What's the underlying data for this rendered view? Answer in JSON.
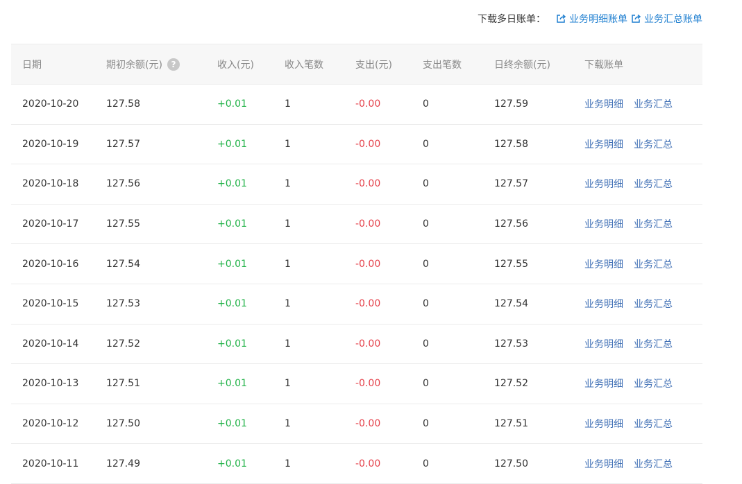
{
  "download_bar": {
    "label": "下载多日账单：",
    "links": [
      {
        "label": "业务明细账单",
        "icon": "external-link-icon"
      },
      {
        "label": "业务汇总账单",
        "icon": "external-link-icon"
      }
    ]
  },
  "table": {
    "headers": [
      "日期",
      "期初余额(元)",
      "收入(元)",
      "收入笔数",
      "支出(元)",
      "支出笔数",
      "日终余额(元)",
      "下载账单"
    ],
    "help_icon": "?",
    "row_links": [
      "业务明细",
      "业务汇总"
    ],
    "colors": {
      "income": "#20b247",
      "expense": "#e5414a",
      "link": "#3f6fb5"
    },
    "rows": [
      {
        "date": "2020-10-20",
        "opening": "127.58",
        "income": "+0.01",
        "income_count": "1",
        "expense": "-0.00",
        "expense_count": "0",
        "closing": "127.59"
      },
      {
        "date": "2020-10-19",
        "opening": "127.57",
        "income": "+0.01",
        "income_count": "1",
        "expense": "-0.00",
        "expense_count": "0",
        "closing": "127.58"
      },
      {
        "date": "2020-10-18",
        "opening": "127.56",
        "income": "+0.01",
        "income_count": "1",
        "expense": "-0.00",
        "expense_count": "0",
        "closing": "127.57"
      },
      {
        "date": "2020-10-17",
        "opening": "127.55",
        "income": "+0.01",
        "income_count": "1",
        "expense": "-0.00",
        "expense_count": "0",
        "closing": "127.56"
      },
      {
        "date": "2020-10-16",
        "opening": "127.54",
        "income": "+0.01",
        "income_count": "1",
        "expense": "-0.00",
        "expense_count": "0",
        "closing": "127.55"
      },
      {
        "date": "2020-10-15",
        "opening": "127.53",
        "income": "+0.01",
        "income_count": "1",
        "expense": "-0.00",
        "expense_count": "0",
        "closing": "127.54"
      },
      {
        "date": "2020-10-14",
        "opening": "127.52",
        "income": "+0.01",
        "income_count": "1",
        "expense": "-0.00",
        "expense_count": "0",
        "closing": "127.53"
      },
      {
        "date": "2020-10-13",
        "opening": "127.51",
        "income": "+0.01",
        "income_count": "1",
        "expense": "-0.00",
        "expense_count": "0",
        "closing": "127.52"
      },
      {
        "date": "2020-10-12",
        "opening": "127.50",
        "income": "+0.01",
        "income_count": "1",
        "expense": "-0.00",
        "expense_count": "0",
        "closing": "127.51"
      },
      {
        "date": "2020-10-11",
        "opening": "127.49",
        "income": "+0.01",
        "income_count": "1",
        "expense": "-0.00",
        "expense_count": "0",
        "closing": "127.50"
      }
    ]
  }
}
